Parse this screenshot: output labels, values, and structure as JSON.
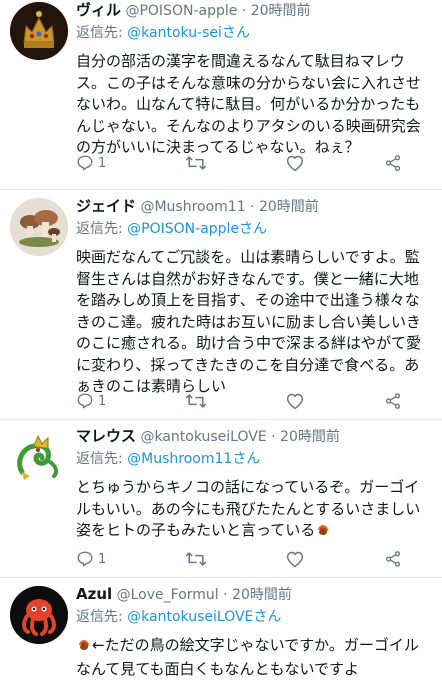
{
  "tweets": [
    {
      "name": "ヴィル",
      "handle": "@POISON-apple",
      "dot": "·",
      "time": "20時間前",
      "reply_prefix": "返信先: ",
      "reply_handle": "@kantoku-sei",
      "reply_suffix": "さん",
      "lines": [
        "自分の部活の漢字を間違えるなんて駄目ねマレウ",
        "ス。この子はそんな意味の分からない会に入れさせ",
        "ないわ。山なんて特に駄目。何がいるか分かったも",
        "んじゃない。そんなのよりアタシのいる映画研究会",
        "の方がいいに決まってるじゃない。ねぇ？"
      ],
      "reply_count": "1",
      "avatar_icon": "crown-avatar-icon"
    },
    {
      "name": "ジェイド",
      "handle": "@Mushroom11",
      "dot": "·",
      "time": "20時間前",
      "reply_prefix": "返信先: ",
      "reply_handle": "@POISON-apple",
      "reply_suffix": "さん",
      "lines": [
        "映画だなんてご冗談を。山は素晴らしいですよ。監",
        "督生さんは自然がお好きなんです。僕と一緒に大地",
        "を踏みしめ頂上を目指す、その途中で出逢う様々な",
        "きのこ達。疲れた時はお互いに励まし合い美しいき",
        "のこに癒される。助け合う中で深まる絆はやがて愛",
        "に変わり、採ってきたきのこを自分達で食べる。あ",
        "ぁきのこは素晴らしい"
      ],
      "reply_count": "1",
      "avatar_icon": "mushroom-avatar-icon"
    },
    {
      "name": "マレウス",
      "handle": "@kantokuseiLOVE",
      "dot": "·",
      "time": "20時間前",
      "reply_prefix": "返信先: ",
      "reply_handle": "@Mushroom11",
      "reply_suffix": "さん",
      "lines": [
        "とちゅうからキノコの話になっているぞ。ガーゴイ",
        "ルもいい。あの今にも飛びたたんとするいさましい",
        "姿をヒトの子もみたいと言っている"
      ],
      "reply_count": "1",
      "avatar_icon": "dragon-avatar-icon",
      "trailing_emoji": "turkey-emoji"
    },
    {
      "name": "Azul",
      "handle": "@Love_Formul",
      "dot": "·",
      "time": "20時間前",
      "reply_prefix": "返信先: ",
      "reply_handle": "@kantokuseiLOVE",
      "reply_suffix": "さん",
      "lines": [
        "←ただの鳥の絵文字じゃないですか。ガーゴイル",
        "なんて見ても面白くもなんともないですよ"
      ],
      "avatar_icon": "octopus-avatar-icon",
      "leading_emoji": "turkey-emoji"
    }
  ],
  "icons": {
    "reply": "reply-icon",
    "retweet": "retweet-icon",
    "like": "like-icon",
    "share": "share-icon"
  },
  "colors": {
    "link": "#1b95e0",
    "secondary_text": "#657786",
    "divider": "#e1e8ed"
  }
}
